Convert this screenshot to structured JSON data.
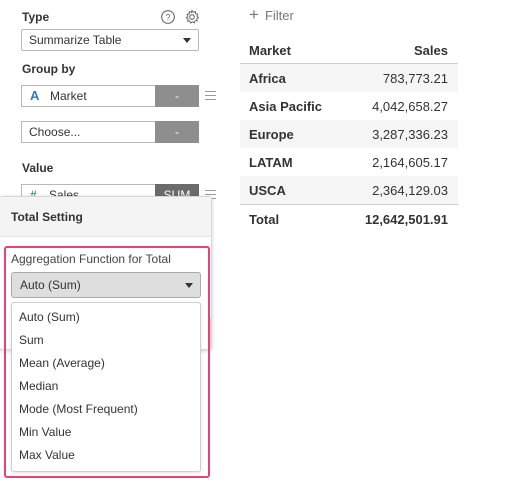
{
  "type_section": {
    "label": "Type",
    "select_value": "Summarize Table",
    "help_icon": "help-icon",
    "settings_icon": "gear-icon"
  },
  "group_by": {
    "label": "Group by",
    "fields": [
      {
        "type_icon": "A",
        "name": "Market",
        "button": "-"
      },
      {
        "type_icon": "",
        "name": "Choose...",
        "button": "-"
      }
    ]
  },
  "value_section": {
    "label": "Value",
    "field": {
      "type_icon": "#",
      "name": "Sales",
      "button": "SUM"
    }
  },
  "total_setting": {
    "title": "Total Setting",
    "aggregation_label": "Aggregation Function for Total",
    "selected": "Auto (Sum)",
    "options": [
      "Auto (Sum)",
      "Sum",
      "Mean (Average)",
      "Median",
      "Mode (Most Frequent)",
      "Min Value",
      "Max Value"
    ]
  },
  "filter": {
    "label": "Filter"
  },
  "table": {
    "columns": [
      "Market",
      "Sales"
    ],
    "rows": [
      [
        "Africa",
        "783,773.21"
      ],
      [
        "Asia Pacific",
        "4,042,658.27"
      ],
      [
        "Europe",
        "3,287,336.23"
      ],
      [
        "LATAM",
        "2,164,605.17"
      ],
      [
        "USCA",
        "2,364,129.03"
      ]
    ],
    "total": [
      "Total",
      "12,642,501.91"
    ]
  },
  "colors": {
    "highlight": "#e8407a",
    "type_text_icon": "#2a7ad5",
    "numeric_icon": "#3aa35a",
    "button_gray": "#8e8e8e"
  }
}
